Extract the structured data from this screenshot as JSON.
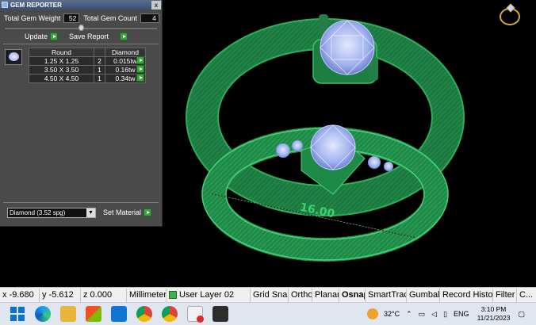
{
  "panel": {
    "title": "GEM REPORTER",
    "close_label": "x",
    "total_weight_label": "Total Gem Weight",
    "total_weight_value": "52",
    "total_count_label": "Total Gem Count",
    "total_count_value": "4",
    "update_label": "Update",
    "save_report_label": "Save Report",
    "table": {
      "headers": [
        "Round",
        "",
        "Diamond"
      ],
      "rows": [
        {
          "size": "1.25 X 1.25",
          "count": "2",
          "weight": "0.015tw"
        },
        {
          "size": "3.50 X 3.50",
          "count": "1",
          "weight": "0.16tw"
        },
        {
          "size": "4.50 X 4.50",
          "count": "1",
          "weight": "0.34tw"
        }
      ]
    },
    "material_value": "Diamond  (3.52 spg)",
    "set_material_label": "Set Material"
  },
  "viewport": {
    "dimension_label": "16.00",
    "ring_color": "#1f8a4a",
    "gem_color": "#a8b8f0"
  },
  "statusbar": {
    "x": "x -9.680",
    "y": "y -5.612",
    "z": "z 0.000",
    "units": "Millimeters",
    "layer": "User Layer 02",
    "grid_snap": "Grid Snap",
    "ortho": "Ortho",
    "planar": "Planar",
    "osnap": "Osnap",
    "smarttrack": "SmartTrack",
    "gumball": "Gumball",
    "record_history": "Record History",
    "filter": "Filter",
    "extra": "C..."
  },
  "taskbar": {
    "temperature": "32°C",
    "language": "ENG",
    "time": "3:10 PM",
    "date": "11/21/2023"
  }
}
